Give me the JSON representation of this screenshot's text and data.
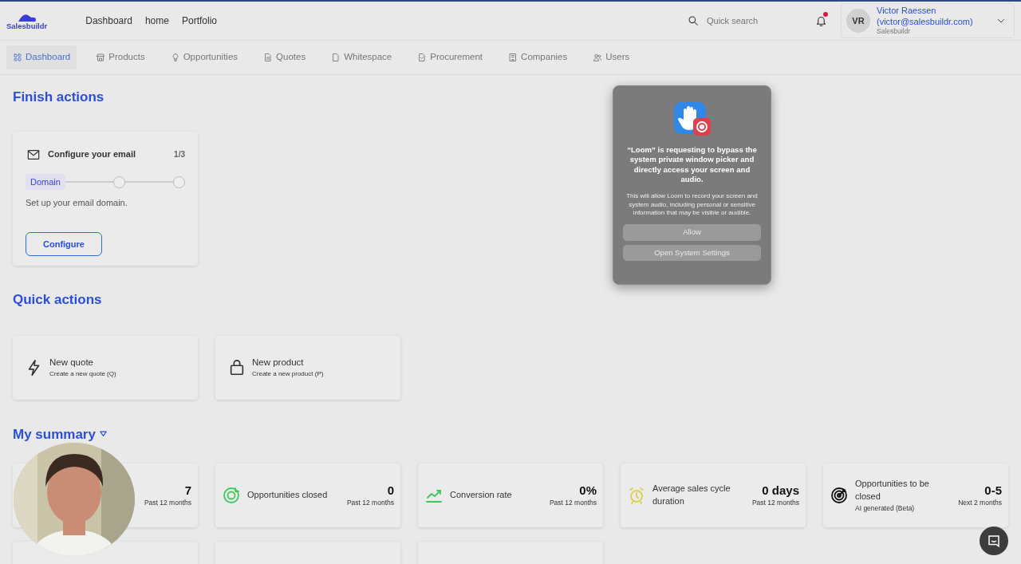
{
  "brand": {
    "name": "Salesbuildr"
  },
  "top_nav": [
    {
      "label": "Dashboard"
    },
    {
      "label": "home"
    },
    {
      "label": "Portfolio"
    }
  ],
  "search": {
    "placeholder": "Quick search"
  },
  "notifications": {
    "unread": true
  },
  "user": {
    "initials": "VR",
    "name": "Victor Raessen",
    "email": "(victor@salesbuildr.com)",
    "company": "Salesbuildr"
  },
  "tabs": [
    {
      "label": "Dashboard",
      "selected": true
    },
    {
      "label": "Products",
      "selected": false
    },
    {
      "label": "Opportunities",
      "selected": false
    },
    {
      "label": "Quotes",
      "selected": false
    },
    {
      "label": "Whitespace",
      "selected": false
    },
    {
      "label": "Procurement",
      "selected": false
    },
    {
      "label": "Companies",
      "selected": false
    },
    {
      "label": "Users",
      "selected": false
    }
  ],
  "finish_actions": {
    "title": "Finish actions",
    "card": {
      "title": "Configure your email",
      "progress": "1/3",
      "steps": [
        {
          "label": "Domain",
          "current": true
        },
        {
          "current": false
        },
        {
          "current": false
        }
      ],
      "description": "Set up your email domain.",
      "button": "Configure"
    }
  },
  "quick_actions": {
    "title": "Quick actions",
    "items": [
      {
        "title": "New quote",
        "subtitle": "Create a new quote (Q)"
      },
      {
        "title": "New product",
        "subtitle": "Create a new product (P)"
      }
    ]
  },
  "summary": {
    "title": "My summary",
    "stats": [
      {
        "value": "7",
        "period": "Past 12 months"
      },
      {
        "label": "Opportunities closed",
        "value": "0",
        "period": "Past 12 months"
      },
      {
        "label": "Conversion rate",
        "value": "0%",
        "period": "Past 12 months"
      },
      {
        "label": "Average sales cycle duration",
        "value": "0 days",
        "period": "Past 12 months"
      },
      {
        "label": "Opportunities to be closed",
        "note": "AI generated (Beta)",
        "value": "0-5",
        "period": "Next 2 months"
      }
    ]
  },
  "dialog": {
    "title": "“Loom” is requesting to bypass the system private window picker and directly access your screen and audio.",
    "message": "This will allow Loom to record your screen and system audio, including personal or sensitive information that may be visible or audible.",
    "buttons": [
      "Allow",
      "Open System Settings"
    ]
  }
}
